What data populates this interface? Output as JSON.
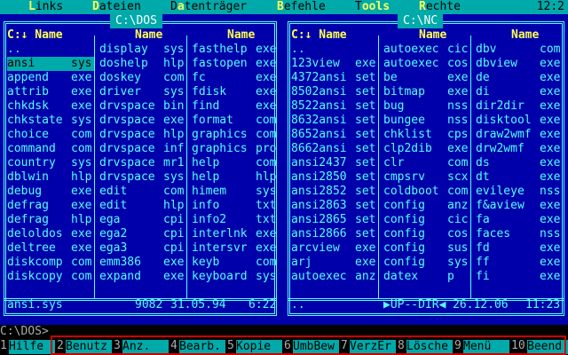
{
  "menubar": {
    "items": [
      {
        "hk": "L",
        "rest": "inks"
      },
      {
        "hk": "D",
        "rest": "ateien"
      },
      {
        "hk": "D",
        "rest": "a",
        "pre": "",
        "alt": "tenträger"
      },
      {
        "hk": "B",
        "rest": "efehle"
      },
      {
        "hk": "T",
        "rest": "ools",
        "pre": ""
      },
      {
        "hk": "R",
        "rest": "echte"
      }
    ],
    "clock": "12:2"
  },
  "left_panel": {
    "title": "C:\\DOS",
    "headers": [
      "C:↓ Name",
      "Name",
      "Name"
    ],
    "columns": [
      [
        [
          "..",
          ""
        ],
        [
          "ansi",
          "sys"
        ],
        [
          "append",
          "exe"
        ],
        [
          "attrib",
          "exe"
        ],
        [
          "chkdsk",
          "exe"
        ],
        [
          "chkstate",
          "sys"
        ],
        [
          "choice",
          "com"
        ],
        [
          "command",
          "com"
        ],
        [
          "country",
          "sys"
        ],
        [
          "dblwin",
          "hlp"
        ],
        [
          "debug",
          "exe"
        ],
        [
          "defrag",
          "exe"
        ],
        [
          "defrag",
          "hlp"
        ],
        [
          "deloldos",
          "exe"
        ],
        [
          "deltree",
          "exe"
        ],
        [
          "diskcomp",
          "com"
        ],
        [
          "diskcopy",
          "com"
        ]
      ],
      [
        [
          "display",
          "sys"
        ],
        [
          "doshelp",
          "hlp"
        ],
        [
          "doskey",
          "com"
        ],
        [
          "driver",
          "sys"
        ],
        [
          "drvspace",
          "bin"
        ],
        [
          "drvspace",
          "exe"
        ],
        [
          "drvspace",
          "hlp"
        ],
        [
          "drvspace",
          "inf"
        ],
        [
          "drvspace",
          "mr1"
        ],
        [
          "drvspace",
          "sys"
        ],
        [
          "edit",
          "com"
        ],
        [
          "edit",
          "hlp"
        ],
        [
          "ega",
          "cpi"
        ],
        [
          "ega2",
          "cpi"
        ],
        [
          "ega3",
          "cpi"
        ],
        [
          "emm386",
          "exe"
        ],
        [
          "expand",
          "exe"
        ]
      ],
      [
        [
          "fasthelp",
          "exe"
        ],
        [
          "fastopen",
          "exe"
        ],
        [
          "fc",
          "exe"
        ],
        [
          "fdisk",
          "exe"
        ],
        [
          "find",
          "exe"
        ],
        [
          "format",
          "com"
        ],
        [
          "graphics",
          "com"
        ],
        [
          "graphics",
          "pro"
        ],
        [
          "help",
          "com"
        ],
        [
          "help",
          "hlp"
        ],
        [
          "himem",
          "sys"
        ],
        [
          "info",
          "txt"
        ],
        [
          "info2",
          "txt"
        ],
        [
          "interlnk",
          "exe"
        ],
        [
          "intersvr",
          "exe"
        ],
        [
          "keyb",
          "com"
        ],
        [
          "keyboard",
          "sys"
        ]
      ]
    ],
    "status": {
      "name": "ansi.sys",
      "size": "9082",
      "date": "31.05.94",
      "time": "6:22"
    }
  },
  "right_panel": {
    "title": "C:\\NC",
    "headers": [
      "C:↓ Name",
      "Name",
      "Name"
    ],
    "columns": [
      [
        [
          "..",
          ""
        ],
        [
          "123view",
          "exe"
        ],
        [
          "4372ansi",
          "set"
        ],
        [
          "8502ansi",
          "set"
        ],
        [
          "8522ansi",
          "set"
        ],
        [
          "8632ansi",
          "set"
        ],
        [
          "8652ansi",
          "set"
        ],
        [
          "8662ansi",
          "set"
        ],
        [
          "ansi2437",
          "set"
        ],
        [
          "ansi2850",
          "set"
        ],
        [
          "ansi2852",
          "set"
        ],
        [
          "ansi2863",
          "set"
        ],
        [
          "ansi2865",
          "set"
        ],
        [
          "ansi2866",
          "set"
        ],
        [
          "arcview",
          "exe"
        ],
        [
          "arj",
          "exe"
        ],
        [
          "autoexec",
          "anz"
        ]
      ],
      [
        [
          "autoexec",
          "cic"
        ],
        [
          "autoexec",
          "cos"
        ],
        [
          "be",
          "exe"
        ],
        [
          "bitmap",
          "exe"
        ],
        [
          "bug",
          "nss"
        ],
        [
          "bungee",
          "nss"
        ],
        [
          "chklist",
          "cps"
        ],
        [
          "clp2dib",
          "exe"
        ],
        [
          "clr",
          "com"
        ],
        [
          "cmpsrv",
          "scx"
        ],
        [
          "coldboot",
          "com"
        ],
        [
          "config",
          "anz"
        ],
        [
          "config",
          "cic"
        ],
        [
          "config",
          "cos"
        ],
        [
          "config",
          "sus"
        ],
        [
          "config",
          "sys"
        ],
        [
          "datex",
          "p"
        ]
      ],
      [
        [
          "dbv",
          "com"
        ],
        [
          "dbview",
          "exe"
        ],
        [
          "de",
          "exe"
        ],
        [
          "di",
          "exe"
        ],
        [
          "dir2dir",
          "exe"
        ],
        [
          "disktool",
          "exe"
        ],
        [
          "draw2wmf",
          "exe"
        ],
        [
          "drw2wmf",
          "exe"
        ],
        [
          "ds",
          "exe"
        ],
        [
          "dt",
          "exe"
        ],
        [
          "evileye",
          "nss"
        ],
        [
          "f&aview",
          "exe"
        ],
        [
          "fa",
          "exe"
        ],
        [
          "faces",
          "nss"
        ],
        [
          "fd",
          "exe"
        ],
        [
          "ff",
          "exe"
        ],
        [
          "fi",
          "exe"
        ]
      ]
    ],
    "status": {
      "name": "..",
      "size": "▶UP--DIR◀",
      "date": "26.12.06",
      "time": "11:23"
    }
  },
  "command_line": "C:\\DOS>",
  "function_keys": [
    {
      "num": "1",
      "label": "Hilfe"
    },
    {
      "num": "2",
      "label": "Benutz"
    },
    {
      "num": "3",
      "label": "Anz."
    },
    {
      "num": "4",
      "label": "Bearb."
    },
    {
      "num": "5",
      "label": "Kopie"
    },
    {
      "num": "6",
      "label": "UmbBew"
    },
    {
      "num": "7",
      "label": "VerzEr"
    },
    {
      "num": "8",
      "label": "Lösche"
    },
    {
      "num": "9",
      "label": "Menü"
    },
    {
      "num": "10",
      "label": "Beend."
    }
  ],
  "colors": {
    "panel_bg": "#0000aa",
    "frame": "#55ffff",
    "selection": "#00aaaa",
    "header": "#ffff55",
    "highlight_box": "#d00000"
  }
}
